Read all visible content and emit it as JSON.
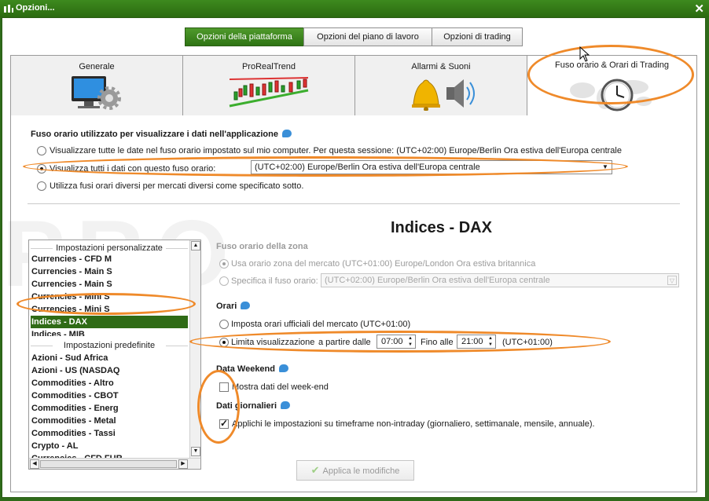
{
  "window": {
    "title": "Opzioni...",
    "close": "✕"
  },
  "top_buttons": [
    {
      "label": "Opzioni della piattaforma",
      "active": true
    },
    {
      "label": "Opzioni del piano di lavoro",
      "active": false
    },
    {
      "label": "Opzioni di trading",
      "active": false
    }
  ],
  "tabs": [
    {
      "label": "Generale",
      "icon": "monitor-gear-icon"
    },
    {
      "label": "ProRealTrend",
      "icon": "trend-chart-icon"
    },
    {
      "label": "Allarmi & Suoni",
      "icon": "bell-speaker-icon"
    },
    {
      "label": "Fuso orario & Orari di Trading",
      "icon": "clock-map-icon",
      "selected": true
    }
  ],
  "timezone_section": {
    "title": "Fuso orario utilizzato per visualizzare i dati nell'applicazione",
    "opt_computer": "Visualizzare tutte le date nel fuso orario impostato sul mio computer. Per questa sessione: (UTC+02:00) Europe/Berlin Ora estiva dell'Europa centrale",
    "opt_fixed": "Visualizza tutti i dati con questo fuso orario:",
    "opt_fixed_value": "(UTC+02:00) Europe/Berlin Ora estiva dell'Europa centrale",
    "opt_per_market": "Utilizza fusi orari diversi per mercati diversi come specificato sotto."
  },
  "list": {
    "group_custom": "Impostazioni personalizzate",
    "group_default": "Impostazioni predefinite",
    "custom_items": [
      "Currencies - CFD M",
      "Currencies - Main S",
      "Currencies - Main S",
      "Currencies - Mini S",
      "Currencies - Mini S",
      "Indices - DAX",
      "Indices - MIB"
    ],
    "default_items": [
      "Azioni - Sud Africa",
      "Azioni - US (NASDAQ",
      "Commodities - Altro",
      "Commodities - CBOT",
      "Commodities - Energ",
      "Commodities - Metal",
      "Commodities - Tassi",
      "Crypto - AL",
      "Currencies - CFD FUR"
    ],
    "selected_index": 5
  },
  "detail": {
    "title": "Indices - DAX",
    "zone_title": "Fuso orario della zona",
    "zone_market": "Usa orario zona del mercato (UTC+01:00) Europe/London Ora estiva britannica",
    "zone_specify": "Specifica il fuso orario:",
    "zone_specify_value": "(UTC+02:00) Europe/Berlin Ora estiva dell'Europa centrale",
    "hours_title": "Orari",
    "hours_official": "Imposta orari ufficiali del mercato  (UTC+01:00)",
    "hours_limit": "Limita visualizzazione",
    "from_label": "a partire dalle",
    "from_value": "07:00",
    "to_label": "Fino alle",
    "to_value": "21:00",
    "hours_tz": "(UTC+01:00)",
    "weekend_title": "Data Weekend",
    "weekend_opt": "Mostra dati del week-end",
    "daily_title": "Dati giornalieri",
    "daily_opt": "Applichi le impostazioni su timeframe non-intraday (giornaliero, settimanale, mensile, annuale)."
  },
  "apply_button": "Applica le modifiche",
  "watermark": "PRO VERSION",
  "colors": {
    "accent": "#2f6b16",
    "highlight": "#ef8a2a"
  }
}
